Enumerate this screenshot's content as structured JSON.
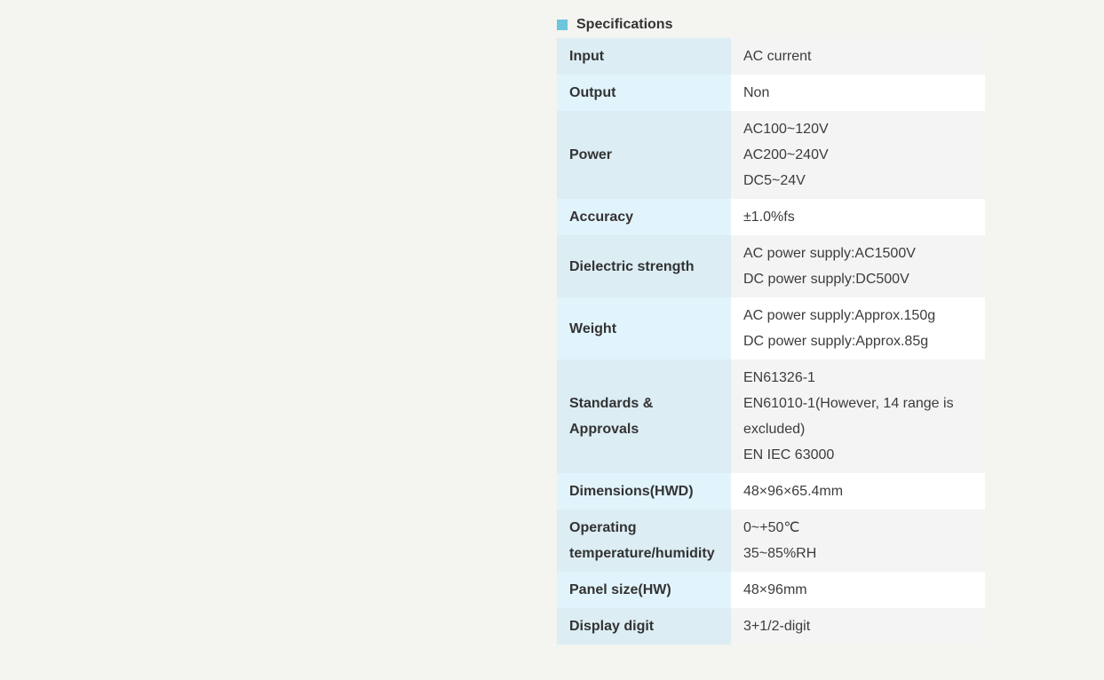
{
  "section": {
    "title": "Specifications",
    "marker_color": "#6cc6dc"
  },
  "specs": [
    {
      "label": "Input",
      "lines": [
        "AC current"
      ]
    },
    {
      "label": "Output",
      "lines": [
        "Non"
      ]
    },
    {
      "label": "Power",
      "lines": [
        "AC100~120V",
        "AC200~240V",
        "DC5~24V"
      ]
    },
    {
      "label": "Accuracy",
      "lines": [
        "±1.0%fs"
      ]
    },
    {
      "label": "Dielectric strength",
      "lines": [
        "AC power supply:AC1500V",
        "DC power supply:DC500V"
      ]
    },
    {
      "label": "Weight",
      "lines": [
        "AC power supply:Approx.150g",
        "DC power supply:Approx.85g"
      ]
    },
    {
      "label": "Standards & Approvals",
      "lines": [
        "EN61326-1",
        "EN61010-1(However, 14 range is excluded)",
        "EN IEC 63000"
      ]
    },
    {
      "label": "Dimensions(HWD)",
      "lines": [
        "48×96×65.4mm"
      ]
    },
    {
      "label": "Operating temperature/humidity",
      "lines": [
        "0~+50℃",
        "35~85%RH"
      ]
    },
    {
      "label": "Panel size(HW)",
      "lines": [
        "48×96mm"
      ]
    },
    {
      "label": "Display digit",
      "lines": [
        "3+1/2-digit"
      ]
    }
  ]
}
